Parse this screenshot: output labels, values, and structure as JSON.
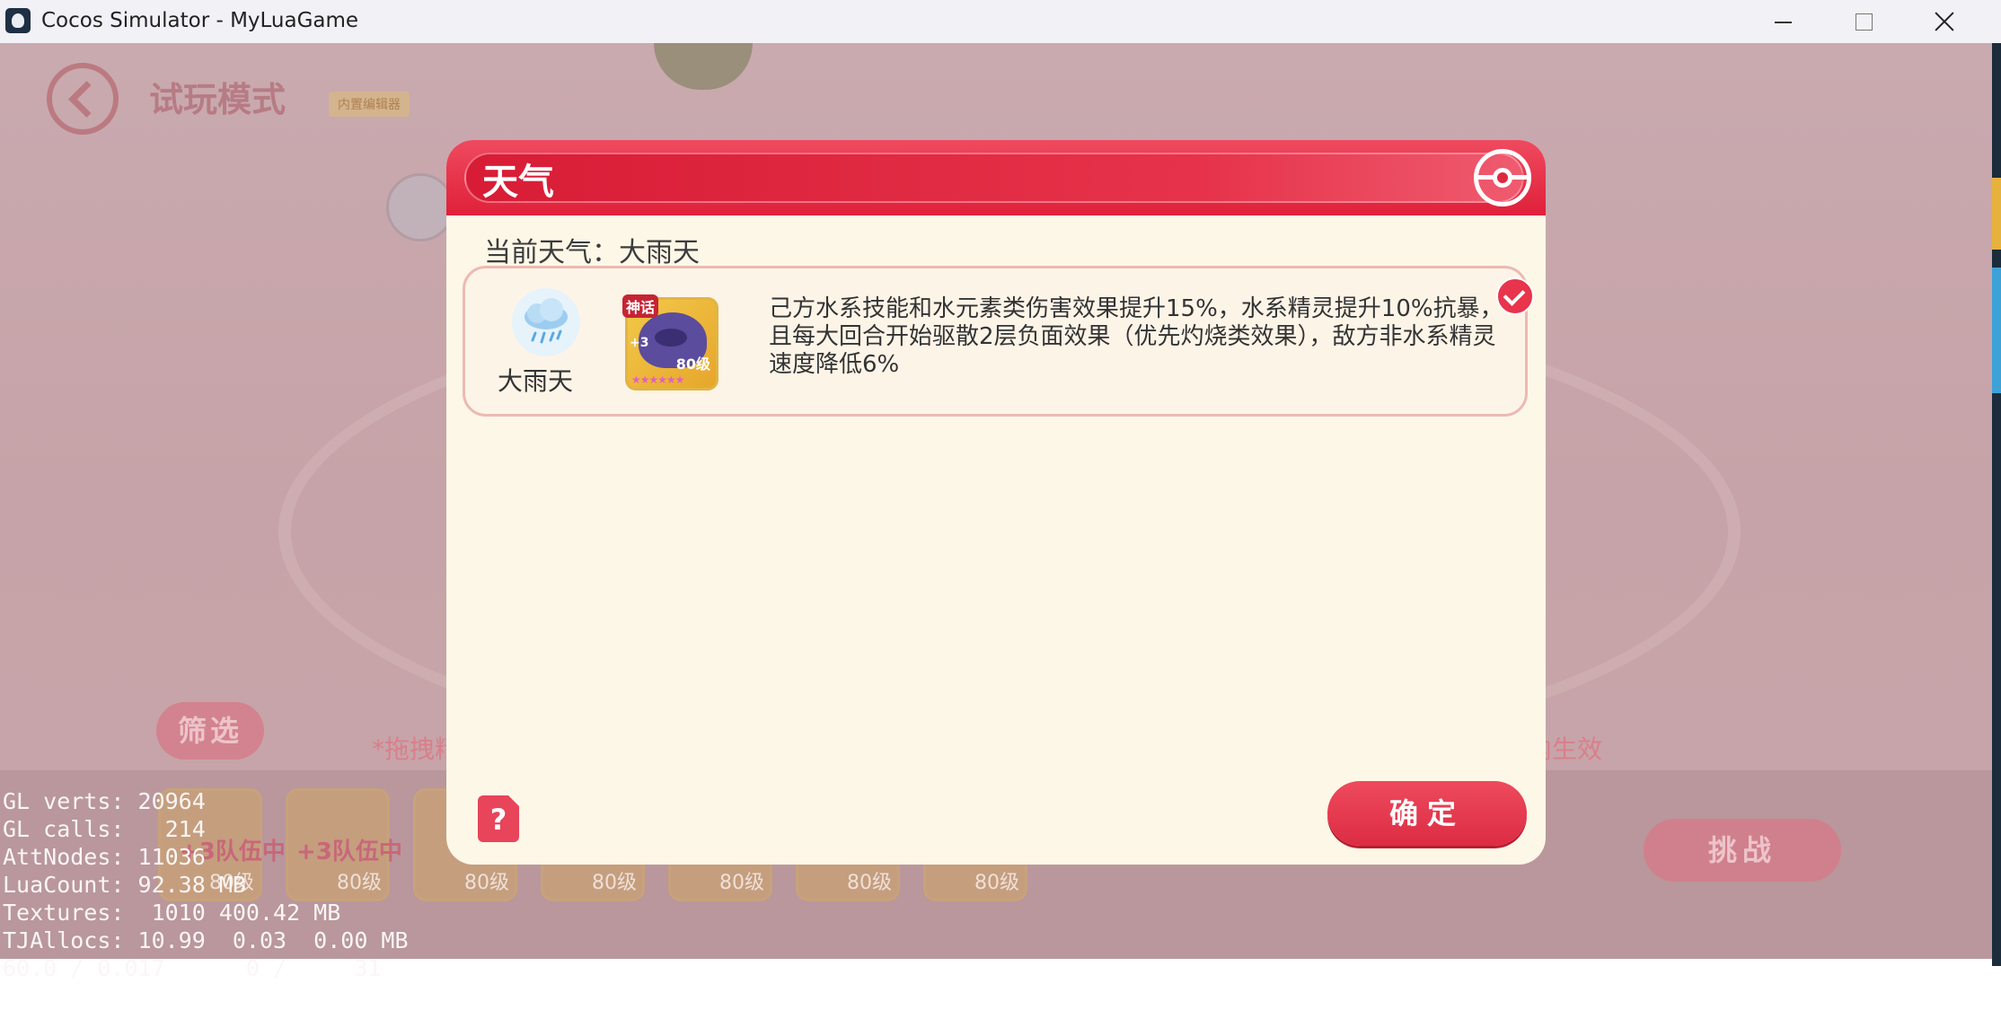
{
  "window": {
    "title": "Cocos Simulator - MyLuaGame"
  },
  "game": {
    "mode_title": "试玩模式",
    "mode_badge": "内置编辑器",
    "filter_label": "筛选",
    "hint_left": "*拖拽精",
    "hint_right": "内生效",
    "challenge_label": "挑战",
    "team_cards": [
      {
        "tag": "神话",
        "status": "+3队伍中",
        "level": "80级"
      },
      {
        "tag": "神话",
        "status": "+3队伍中",
        "level": "80级"
      },
      {
        "tag": "",
        "status": "",
        "level": "80级"
      },
      {
        "tag": "",
        "status": "",
        "level": "80级"
      },
      {
        "tag": "",
        "status": "",
        "level": "80级"
      },
      {
        "tag": "",
        "status": "",
        "level": "80级"
      },
      {
        "tag": "",
        "status": "",
        "level": "80级"
      }
    ]
  },
  "stats": {
    "lines": [
      "GL verts: 20964",
      "GL calls:   214",
      "AttNodes: 11036",
      "LuaCount: 92.38 MB",
      "Textures:  1010 400.42 MB",
      "TJAllocs: 10.99  0.03  0.00 MB",
      "60.0 / 0.017      0 /     31"
    ]
  },
  "dialog": {
    "title": "天气",
    "current_weather": "当前天气：大雨天",
    "weather_entry": {
      "name": "大雨天",
      "icon": "rain-cloud-icon",
      "pet": {
        "tag": "神话",
        "plus": "+3",
        "level": "80级",
        "stars": "★★★★★★"
      },
      "effect": "己方水系技能和水元素类伤害效果提升15%，水系精灵提升10%抗暴，且每大回合开始驱散2层负面效果（优先灼烧类效果），敌方非水系精灵速度降低6%",
      "selected": true
    },
    "confirm_label": "确定",
    "help_symbol": "?"
  },
  "colors": {
    "header_red": "#e0203a",
    "dialog_bg": "#fdf7e7",
    "confirm_red": "#e8344c"
  }
}
